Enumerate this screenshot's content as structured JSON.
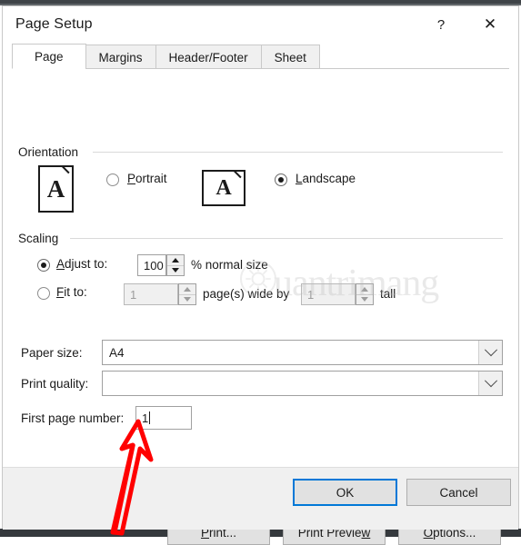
{
  "window": {
    "title": "Page Setup",
    "help_icon": "?",
    "close_icon": "✕",
    "accent_focus_color": "#0078D7"
  },
  "tabs": [
    {
      "label": "Page",
      "active": true
    },
    {
      "label": "Margins",
      "active": false
    },
    {
      "label": "Header/Footer",
      "active": false
    },
    {
      "label": "Sheet",
      "active": false
    }
  ],
  "orientation": {
    "group_label": "Orientation",
    "portrait": {
      "label": "Portrait",
      "accel": "P",
      "selected": false,
      "icon_glyph": "A",
      "icon_name": "portrait-page-icon"
    },
    "landscape": {
      "label": "Landscape",
      "accel": "L",
      "selected": true,
      "icon_glyph": "A",
      "icon_name": "landscape-page-icon"
    }
  },
  "scaling": {
    "group_label": "Scaling",
    "adjust_to": {
      "label": "Adjust to:",
      "accel": "A",
      "selected": true,
      "value": "100",
      "suffix": "% normal size",
      "enabled": true
    },
    "fit_to": {
      "label": "Fit to:",
      "accel": "F",
      "selected": false,
      "wide_value": "1",
      "middle_text": "page(s) wide by",
      "tall_value": "1",
      "suffix": "tall",
      "enabled": false
    }
  },
  "paper_size": {
    "label": "Paper size:",
    "label_text": "Paper size:",
    "accel": "z",
    "value": "A4"
  },
  "print_quality": {
    "label_text": "Print quality:",
    "accel": "q",
    "value": ""
  },
  "first_page_number": {
    "label_text": "First page number:",
    "accel": "r",
    "value": "1",
    "has_caret": true
  },
  "action_buttons": [
    {
      "name": "print-button",
      "label": "Print...",
      "accel": "P"
    },
    {
      "name": "print-preview-button",
      "label": "Print Preview",
      "accel": "w"
    },
    {
      "name": "options-button",
      "label": "Options...",
      "accel": "O"
    }
  ],
  "footer_buttons": [
    {
      "name": "ok-button",
      "label": "OK",
      "focused": true
    },
    {
      "name": "cancel-button",
      "label": "Cancel",
      "focused": false
    }
  ],
  "watermark": {
    "text": "uantrimang",
    "full_text": "Quantrimang",
    "color": "#B9B9B9"
  },
  "annotation": {
    "type": "hand-drawn-arrow",
    "color": "#FF0000",
    "points_to": "first-page-number-input",
    "direction": "up"
  }
}
